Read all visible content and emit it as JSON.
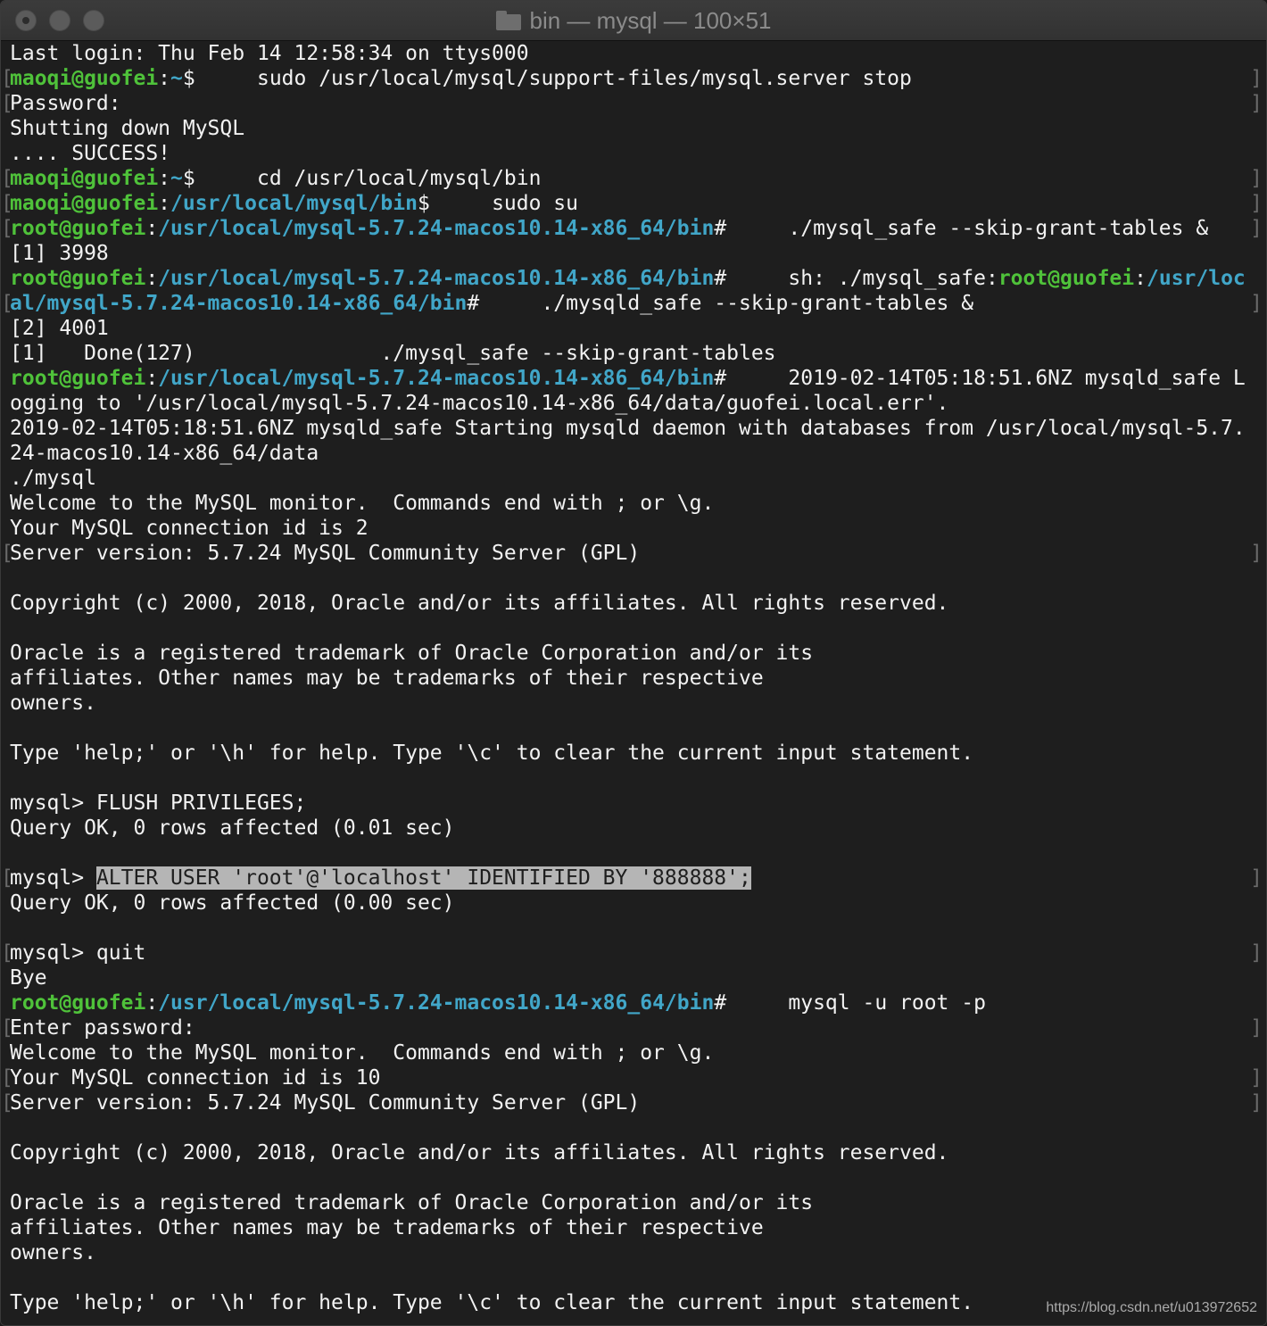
{
  "window": {
    "title": "bin — mysql — 100×51",
    "icons": {
      "folder": "folder-icon"
    }
  },
  "terminal": {
    "lines": [
      {
        "marked": false,
        "segs": [
          {
            "t": "Last login: Thu Feb 14 12:58:34 on ttys000",
            "s": ""
          }
        ]
      },
      {
        "marked": true,
        "segs": [
          {
            "t": "maoqi@guofei",
            "s": "g"
          },
          {
            "t": ":",
            "s": ""
          },
          {
            "t": "~",
            "s": "c"
          },
          {
            "t": "$     sudo /usr/local/mysql/support-files/mysql.server stop",
            "s": ""
          }
        ]
      },
      {
        "marked": true,
        "segs": [
          {
            "t": "Password:",
            "s": ""
          }
        ]
      },
      {
        "marked": false,
        "segs": [
          {
            "t": "Shutting down MySQL",
            "s": ""
          }
        ]
      },
      {
        "marked": false,
        "segs": [
          {
            "t": ".... SUCCESS!",
            "s": ""
          }
        ]
      },
      {
        "marked": true,
        "segs": [
          {
            "t": "maoqi@guofei",
            "s": "g"
          },
          {
            "t": ":",
            "s": ""
          },
          {
            "t": "~",
            "s": "c"
          },
          {
            "t": "$     cd /usr/local/mysql/bin",
            "s": ""
          }
        ]
      },
      {
        "marked": true,
        "segs": [
          {
            "t": "maoqi@guofei",
            "s": "g"
          },
          {
            "t": ":",
            "s": ""
          },
          {
            "t": "/usr/local/mysql/bin",
            "s": "c"
          },
          {
            "t": "$     sudo su",
            "s": ""
          }
        ]
      },
      {
        "marked": true,
        "segs": [
          {
            "t": "root@guofei",
            "s": "g"
          },
          {
            "t": ":",
            "s": ""
          },
          {
            "t": "/usr/local/mysql-5.7.24-macos10.14-x86_64/bin",
            "s": "c"
          },
          {
            "t": "#     ./mysql_safe --skip-grant-tables &",
            "s": ""
          }
        ]
      },
      {
        "marked": false,
        "segs": [
          {
            "t": "[1] 3998",
            "s": ""
          }
        ]
      },
      {
        "marked": false,
        "segs": [
          {
            "t": "root@guofei",
            "s": "g"
          },
          {
            "t": ":",
            "s": ""
          },
          {
            "t": "/usr/local/mysql-5.7.24-macos10.14-x86_64/bin",
            "s": "c"
          },
          {
            "t": "#     sh: ./mysql_safe:",
            "s": ""
          },
          {
            "t": "root@guofei",
            "s": "g"
          },
          {
            "t": ":",
            "s": ""
          },
          {
            "t": "/usr/loc",
            "s": "c"
          }
        ]
      },
      {
        "marked": true,
        "segs": [
          {
            "t": "al/mysql-5.7.24-macos10.14-x86_64/bin",
            "s": "c"
          },
          {
            "t": "#     ./mysqld_safe --skip-grant-tables &",
            "s": ""
          }
        ]
      },
      {
        "marked": false,
        "segs": [
          {
            "t": "[2] 4001",
            "s": ""
          }
        ]
      },
      {
        "marked": false,
        "segs": [
          {
            "t": "[1]   Done(127)               ./mysql_safe --skip-grant-tables",
            "s": ""
          }
        ]
      },
      {
        "marked": false,
        "segs": [
          {
            "t": "root@guofei",
            "s": "g"
          },
          {
            "t": ":",
            "s": ""
          },
          {
            "t": "/usr/local/mysql-5.7.24-macos10.14-x86_64/bin",
            "s": "c"
          },
          {
            "t": "#     2019-02-14T05:18:51.6NZ mysqld_safe L",
            "s": ""
          }
        ]
      },
      {
        "marked": false,
        "segs": [
          {
            "t": "ogging to '/usr/local/mysql-5.7.24-macos10.14-x86_64/data/guofei.local.err'.",
            "s": ""
          }
        ]
      },
      {
        "marked": false,
        "segs": [
          {
            "t": "2019-02-14T05:18:51.6NZ mysqld_safe Starting mysqld daemon with databases from /usr/local/mysql-5.7.",
            "s": ""
          }
        ]
      },
      {
        "marked": false,
        "segs": [
          {
            "t": "24-macos10.14-x86_64/data",
            "s": ""
          }
        ]
      },
      {
        "marked": false,
        "segs": [
          {
            "t": "./mysql",
            "s": ""
          }
        ]
      },
      {
        "marked": false,
        "segs": [
          {
            "t": "Welcome to the MySQL monitor.  Commands end with ; or \\g.",
            "s": ""
          }
        ]
      },
      {
        "marked": false,
        "segs": [
          {
            "t": "Your MySQL connection id is 2",
            "s": ""
          }
        ]
      },
      {
        "marked": true,
        "segs": [
          {
            "t": "Server version: 5.7.24 MySQL Community Server (GPL)",
            "s": ""
          }
        ]
      },
      {
        "marked": false,
        "segs": [
          {
            "t": "",
            "s": ""
          }
        ]
      },
      {
        "marked": false,
        "segs": [
          {
            "t": "Copyright (c) 2000, 2018, Oracle and/or its affiliates. All rights reserved.",
            "s": ""
          }
        ]
      },
      {
        "marked": false,
        "segs": [
          {
            "t": "",
            "s": ""
          }
        ]
      },
      {
        "marked": false,
        "segs": [
          {
            "t": "Oracle is a registered trademark of Oracle Corporation and/or its",
            "s": ""
          }
        ]
      },
      {
        "marked": false,
        "segs": [
          {
            "t": "affiliates. Other names may be trademarks of their respective",
            "s": ""
          }
        ]
      },
      {
        "marked": false,
        "segs": [
          {
            "t": "owners.",
            "s": ""
          }
        ]
      },
      {
        "marked": false,
        "segs": [
          {
            "t": "",
            "s": ""
          }
        ]
      },
      {
        "marked": false,
        "segs": [
          {
            "t": "Type 'help;' or '\\h' for help. Type '\\c' to clear the current input statement.",
            "s": ""
          }
        ]
      },
      {
        "marked": false,
        "segs": [
          {
            "t": "",
            "s": ""
          }
        ]
      },
      {
        "marked": false,
        "segs": [
          {
            "t": "mysql> FLUSH PRIVILEGES;",
            "s": ""
          }
        ]
      },
      {
        "marked": false,
        "segs": [
          {
            "t": "Query OK, 0 rows affected (0.01 sec)",
            "s": ""
          }
        ]
      },
      {
        "marked": false,
        "segs": [
          {
            "t": "",
            "s": ""
          }
        ]
      },
      {
        "marked": true,
        "segs": [
          {
            "t": "mysql> ",
            "s": ""
          },
          {
            "t": "ALTER USER 'root'@'localhost' IDENTIFIED BY '888888';",
            "s": "hl"
          }
        ]
      },
      {
        "marked": false,
        "segs": [
          {
            "t": "Query OK, 0 rows affected (0.00 sec)",
            "s": ""
          }
        ]
      },
      {
        "marked": false,
        "segs": [
          {
            "t": "",
            "s": ""
          }
        ]
      },
      {
        "marked": true,
        "segs": [
          {
            "t": "mysql> quit",
            "s": ""
          }
        ]
      },
      {
        "marked": false,
        "segs": [
          {
            "t": "Bye",
            "s": ""
          }
        ]
      },
      {
        "marked": false,
        "segs": [
          {
            "t": "root@guofei",
            "s": "g"
          },
          {
            "t": ":",
            "s": ""
          },
          {
            "t": "/usr/local/mysql-5.7.24-macos10.14-x86_64/bin",
            "s": "c"
          },
          {
            "t": "#     mysql -u root -p",
            "s": ""
          }
        ]
      },
      {
        "marked": true,
        "segs": [
          {
            "t": "Enter password:",
            "s": ""
          }
        ]
      },
      {
        "marked": false,
        "segs": [
          {
            "t": "Welcome to the MySQL monitor.  Commands end with ; or \\g.",
            "s": ""
          }
        ]
      },
      {
        "marked": true,
        "segs": [
          {
            "t": "Your MySQL connection id is 10",
            "s": ""
          }
        ]
      },
      {
        "marked": true,
        "segs": [
          {
            "t": "Server version: 5.7.24 MySQL Community Server (GPL)",
            "s": ""
          }
        ]
      },
      {
        "marked": false,
        "segs": [
          {
            "t": "",
            "s": ""
          }
        ]
      },
      {
        "marked": false,
        "segs": [
          {
            "t": "Copyright (c) 2000, 2018, Oracle and/or its affiliates. All rights reserved.",
            "s": ""
          }
        ]
      },
      {
        "marked": false,
        "segs": [
          {
            "t": "",
            "s": ""
          }
        ]
      },
      {
        "marked": false,
        "segs": [
          {
            "t": "Oracle is a registered trademark of Oracle Corporation and/or its",
            "s": ""
          }
        ]
      },
      {
        "marked": false,
        "segs": [
          {
            "t": "affiliates. Other names may be trademarks of their respective",
            "s": ""
          }
        ]
      },
      {
        "marked": false,
        "segs": [
          {
            "t": "owners.",
            "s": ""
          }
        ]
      },
      {
        "marked": false,
        "segs": [
          {
            "t": "",
            "s": ""
          }
        ]
      },
      {
        "marked": false,
        "segs": [
          {
            "t": "Type 'help;' or '\\h' for help. Type '\\c' to clear the current input statement.",
            "s": ""
          }
        ]
      }
    ]
  },
  "watermark": "https://blog.csdn.net/u013972652",
  "colors": {
    "background": "#1e1e1e",
    "text": "#f2f2f2",
    "prompt_user": "#4fc23a",
    "prompt_path": "#41a6c8",
    "selection": "#b5b5b5"
  }
}
